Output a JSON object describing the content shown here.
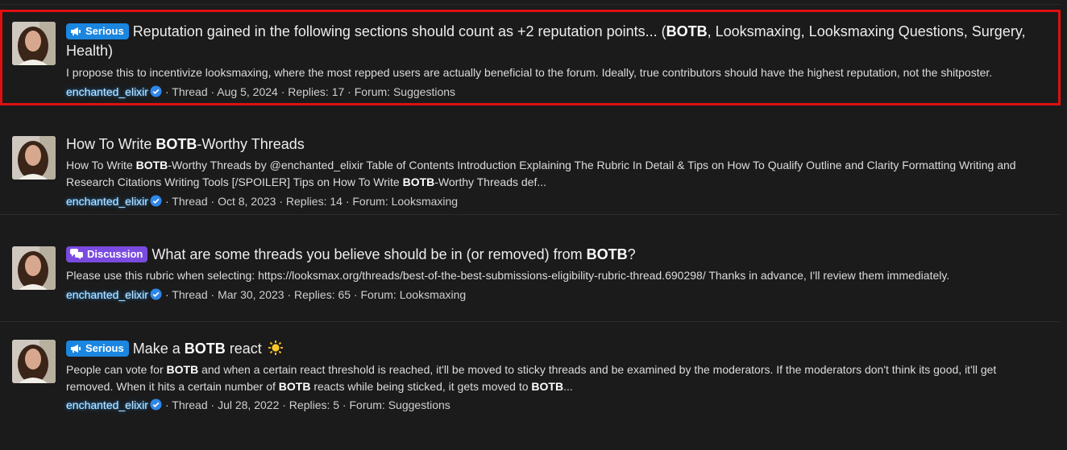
{
  "results": [
    {
      "badge": "Serious",
      "title_pre": "Reputation gained in the following sections should count as +2 reputation points... (",
      "title_bold": "BOTB",
      "title_post": ", Looksmaxing, Looksmaxing Questions, Surgery, Health)",
      "snippet_1": "I propose this to incentivize looksmaxing, where the most repped users are actually beneficial to the forum. Ideally, true contributors should have the highest reputation, not the shitposter.",
      "user": "enchanted_elixir",
      "meta": "· Thread · Aug 5, 2024 · Replies: 17 · Forum: Suggestions"
    },
    {
      "title_pre": "How To Write ",
      "title_bold": "BOTB",
      "title_post": "-Worthy Threads",
      "snippet_a": "How To Write ",
      "snippet_b": "BOTB",
      "snippet_c": "-Worthy Threads by @enchanted_elixir Table of Contents Introduction Explaining The Rubric In Detail & Tips on How To Qualify Outline and Clarity Formatting Writing and Research Citations Writing Tools [/SPOILER] Tips on How To Write ",
      "snippet_d": "BOTB",
      "snippet_e": "-Worthy Threads def...",
      "user": "enchanted_elixir",
      "meta": "· Thread · Oct 8, 2023 · Replies: 14 · Forum: Looksmaxing"
    },
    {
      "badge": "Discussion",
      "title_pre": "What are some threads you believe should be in (or removed) from ",
      "title_bold": "BOTB",
      "title_post": "?",
      "snippet_1": "Please use this rubric when selecting: https://looksmax.org/threads/best-of-the-best-submissions-eligibility-rubric-thread.690298/ Thanks in advance, I'll review them immediately.",
      "user": "enchanted_elixir",
      "meta": "· Thread · Mar 30, 2023 · Replies: 65 · Forum: Looksmaxing"
    },
    {
      "badge": "Serious",
      "title_pre": "Make a ",
      "title_bold": "BOTB",
      "title_post": " react",
      "snippet_a": "People can vote for ",
      "snippet_b": "BOTB",
      "snippet_c": " and when a certain react threshold is reached, it'll be moved to sticky threads and be examined by the moderators. If the moderators don't think its good, it'll get removed. When it hits a certain number of ",
      "snippet_d": "BOTB",
      "snippet_e": " reacts while being sticked, it gets moved to ",
      "snippet_f": "BOTB",
      "snippet_g": "...",
      "user": "enchanted_elixir",
      "meta": "· Thread · Jul 28, 2022 · Replies: 5 · Forum: Suggestions"
    }
  ]
}
